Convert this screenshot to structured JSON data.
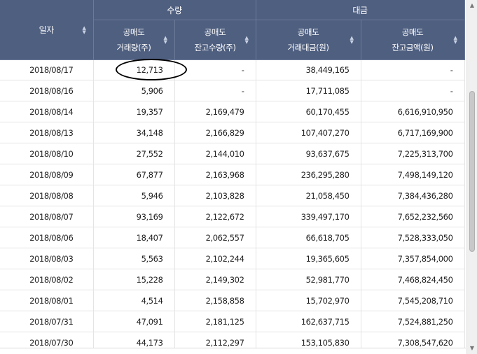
{
  "header": {
    "date_label": "일자",
    "group_volume": "수량",
    "group_amount": "대금",
    "columns": [
      {
        "line1": "공매도",
        "line2": "거래량(주)"
      },
      {
        "line1": "공매도",
        "line2": "잔고수량(주)"
      },
      {
        "line1": "공매도",
        "line2": "거래대금(원)"
      },
      {
        "line1": "공매도",
        "line2": "잔고금액(원)"
      }
    ]
  },
  "icons": {
    "sort": "sort-updown-icon",
    "scroll_up": "scroll-up-arrow-icon",
    "scroll_down": "scroll-down-arrow-icon"
  },
  "colors": {
    "header_bg": "#4f5f80",
    "header_text": "#ffffff",
    "annotation": "#000000"
  },
  "rows": [
    {
      "date": "2018/08/17",
      "vol": "12,713",
      "bal_qty": "-",
      "amount": "38,449,165",
      "bal_amt": "-"
    },
    {
      "date": "2018/08/16",
      "vol": "5,906",
      "bal_qty": "-",
      "amount": "17,711,085",
      "bal_amt": "-"
    },
    {
      "date": "2018/08/14",
      "vol": "19,357",
      "bal_qty": "2,169,479",
      "amount": "60,170,455",
      "bal_amt": "6,616,910,950"
    },
    {
      "date": "2018/08/13",
      "vol": "34,148",
      "bal_qty": "2,166,829",
      "amount": "107,407,270",
      "bal_amt": "6,717,169,900"
    },
    {
      "date": "2018/08/10",
      "vol": "27,552",
      "bal_qty": "2,144,010",
      "amount": "93,637,675",
      "bal_amt": "7,225,313,700"
    },
    {
      "date": "2018/08/09",
      "vol": "67,877",
      "bal_qty": "2,163,968",
      "amount": "236,295,280",
      "bal_amt": "7,498,149,120"
    },
    {
      "date": "2018/08/08",
      "vol": "5,946",
      "bal_qty": "2,103,828",
      "amount": "21,058,450",
      "bal_amt": "7,384,436,280"
    },
    {
      "date": "2018/08/07",
      "vol": "93,169",
      "bal_qty": "2,122,672",
      "amount": "339,497,170",
      "bal_amt": "7,652,232,560"
    },
    {
      "date": "2018/08/06",
      "vol": "18,407",
      "bal_qty": "2,062,557",
      "amount": "66,618,705",
      "bal_amt": "7,528,333,050"
    },
    {
      "date": "2018/08/03",
      "vol": "5,563",
      "bal_qty": "2,102,244",
      "amount": "19,365,605",
      "bal_amt": "7,357,854,000"
    },
    {
      "date": "2018/08/02",
      "vol": "15,228",
      "bal_qty": "2,149,302",
      "amount": "52,981,770",
      "bal_amt": "7,468,824,450"
    },
    {
      "date": "2018/08/01",
      "vol": "4,514",
      "bal_qty": "2,158,858",
      "amount": "15,702,970",
      "bal_amt": "7,545,208,710"
    },
    {
      "date": "2018/07/31",
      "vol": "47,091",
      "bal_qty": "2,181,125",
      "amount": "162,637,715",
      "bal_amt": "7,524,881,250"
    },
    {
      "date": "2018/07/30",
      "vol": "44,173",
      "bal_qty": "2,112,297",
      "amount": "153,105,830",
      "bal_amt": "7,308,547,620"
    }
  ]
}
